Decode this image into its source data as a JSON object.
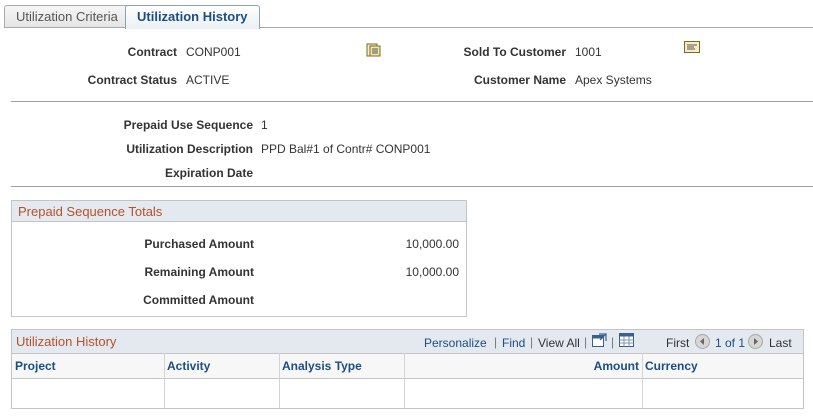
{
  "tabs": [
    {
      "label": "Utilization Criteria",
      "active": false
    },
    {
      "label": "Utilization History",
      "active": true
    }
  ],
  "header": {
    "contract_label": "Contract",
    "contract_value": "CONP001",
    "contract_status_label": "Contract Status",
    "contract_status_value": "ACTIVE",
    "sold_to_label": "Sold To Customer",
    "sold_to_value": "1001",
    "customer_name_label": "Customer Name",
    "customer_name_value": "Apex Systems"
  },
  "prepaid": {
    "sequence_label": "Prepaid Use Sequence",
    "sequence_value": "1",
    "description_label": "Utilization Description",
    "description_value": "PPD Bal#1 of Contr# CONP001",
    "expiration_label": "Expiration Date",
    "expiration_value": ""
  },
  "totals": {
    "title": "Prepaid Sequence Totals",
    "purchased_label": "Purchased Amount",
    "purchased_value": "10,000.00",
    "remaining_label": "Remaining Amount",
    "remaining_value": "10,000.00",
    "committed_label": "Committed Amount",
    "committed_value": ""
  },
  "grid": {
    "title": "Utilization History",
    "personalize": "Personalize",
    "find": "Find",
    "view_all": "View All",
    "first": "First",
    "range": "1 of 1",
    "last": "Last",
    "columns": [
      "Project",
      "Activity",
      "Analysis Type",
      "Amount",
      "Currency"
    ]
  },
  "colors": {
    "link": "#1b4e84",
    "section_title": "#b55229",
    "header_bg": "#e3e9ef"
  },
  "icons": {
    "contract_lookup": "document-list-icon",
    "customer_lookup": "address-card-icon",
    "zoom": "new-window-icon",
    "download": "spreadsheet-icon",
    "prev": "arrow-left-icon",
    "next": "arrow-right-icon"
  }
}
